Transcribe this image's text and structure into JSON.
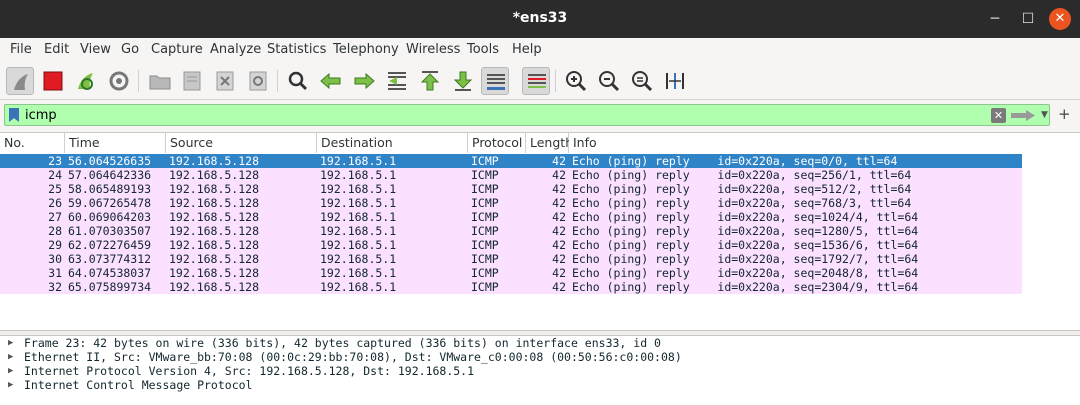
{
  "window": {
    "title": "*ens33",
    "minimize": "─",
    "maximize": "☐",
    "close": "✕"
  },
  "menubar": {
    "items": [
      "File",
      "Edit",
      "View",
      "Go",
      "Capture",
      "Analyze",
      "Statistics",
      "Telephony",
      "Wireless",
      "Tools",
      "Help"
    ]
  },
  "toolbar": {
    "icons": [
      "shark-fin-start-icon",
      "stop-capture-icon",
      "restart-capture-icon",
      "capture-options-icon",
      "open-file-icon",
      "save-file-icon",
      "close-file-icon",
      "reload-file-icon",
      "find-packet-icon",
      "go-back-icon",
      "go-forward-icon",
      "go-to-packet-icon",
      "first-packet-icon",
      "last-packet-icon",
      "auto-scroll-icon",
      "colorize-icon",
      "zoom-in-icon",
      "zoom-out-icon",
      "zoom-normal-icon",
      "resize-columns-icon"
    ]
  },
  "filter": {
    "value": "icmp",
    "add_label": "+"
  },
  "packet_list": {
    "columns": [
      "No.",
      "Time",
      "Source",
      "Destination",
      "Protocol",
      "Length",
      "Info"
    ],
    "rows": [
      {
        "no": "23",
        "time": "56.064526635",
        "source": "192.168.5.128",
        "destination": "192.168.5.1",
        "protocol": "ICMP",
        "length": "42",
        "info": "Echo (ping) reply    id=0x220a, seq=0/0, ttl=64",
        "selected": true
      },
      {
        "no": "24",
        "time": "57.064642336",
        "source": "192.168.5.128",
        "destination": "192.168.5.1",
        "protocol": "ICMP",
        "length": "42",
        "info": "Echo (ping) reply    id=0x220a, seq=256/1, ttl=64"
      },
      {
        "no": "25",
        "time": "58.065489193",
        "source": "192.168.5.128",
        "destination": "192.168.5.1",
        "protocol": "ICMP",
        "length": "42",
        "info": "Echo (ping) reply    id=0x220a, seq=512/2, ttl=64"
      },
      {
        "no": "26",
        "time": "59.067265478",
        "source": "192.168.5.128",
        "destination": "192.168.5.1",
        "protocol": "ICMP",
        "length": "42",
        "info": "Echo (ping) reply    id=0x220a, seq=768/3, ttl=64"
      },
      {
        "no": "27",
        "time": "60.069064203",
        "source": "192.168.5.128",
        "destination": "192.168.5.1",
        "protocol": "ICMP",
        "length": "42",
        "info": "Echo (ping) reply    id=0x220a, seq=1024/4, ttl=64"
      },
      {
        "no": "28",
        "time": "61.070303507",
        "source": "192.168.5.128",
        "destination": "192.168.5.1",
        "protocol": "ICMP",
        "length": "42",
        "info": "Echo (ping) reply    id=0x220a, seq=1280/5, ttl=64"
      },
      {
        "no": "29",
        "time": "62.072276459",
        "source": "192.168.5.128",
        "destination": "192.168.5.1",
        "protocol": "ICMP",
        "length": "42",
        "info": "Echo (ping) reply    id=0x220a, seq=1536/6, ttl=64"
      },
      {
        "no": "30",
        "time": "63.073774312",
        "source": "192.168.5.128",
        "destination": "192.168.5.1",
        "protocol": "ICMP",
        "length": "42",
        "info": "Echo (ping) reply    id=0x220a, seq=1792/7, ttl=64"
      },
      {
        "no": "31",
        "time": "64.074538037",
        "source": "192.168.5.128",
        "destination": "192.168.5.1",
        "protocol": "ICMP",
        "length": "42",
        "info": "Echo (ping) reply    id=0x220a, seq=2048/8, ttl=64"
      },
      {
        "no": "32",
        "time": "65.075899734",
        "source": "192.168.5.128",
        "destination": "192.168.5.1",
        "protocol": "ICMP",
        "length": "42",
        "info": "Echo (ping) reply    id=0x220a, seq=2304/9, ttl=64"
      }
    ]
  },
  "details": {
    "lines": [
      "Frame 23: 42 bytes on wire (336 bits), 42 bytes captured (336 bits) on interface ens33, id 0",
      "Ethernet II, Src: VMware_bb:70:08 (00:0c:29:bb:70:08), Dst: VMware_c0:00:08 (00:50:56:c0:00:08)",
      "Internet Protocol Version 4, Src: 192.168.5.128, Dst: 192.168.5.1",
      "Internet Control Message Protocol"
    ],
    "expander": "▶"
  },
  "colors": {
    "selected_row": "#2f83c7",
    "icmp_row": "#fce0ff",
    "filter_ok": "#afffaf",
    "titlebar": "#2b2b2b",
    "close_button": "#e95420"
  }
}
